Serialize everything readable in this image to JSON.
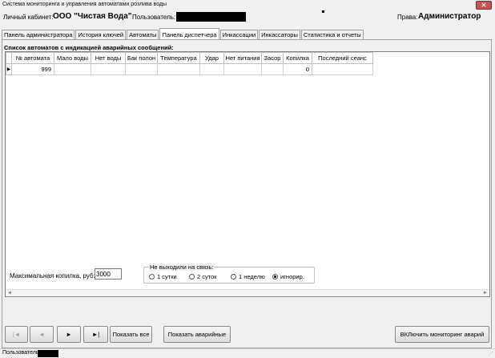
{
  "window": {
    "title": "Система мониторинга и управления автоматами розлива воды",
    "close_glyph": "✕"
  },
  "header": {
    "cabinet_label": "Личный кабинет:",
    "org_name": "ООО \"Чистая Вода\"",
    "user_label": "Пользователь:",
    "rights_label": "Права:",
    "rights_value": "Администратор"
  },
  "tabs": [
    {
      "label": "Панель администратора"
    },
    {
      "label": "История ключей"
    },
    {
      "label": "Автоматы"
    },
    {
      "label": "Панель диспетчера",
      "active": true
    },
    {
      "label": "Инкассации"
    },
    {
      "label": "Инкассаторы"
    },
    {
      "label": "Статистика и отчеты"
    }
  ],
  "panel": {
    "section_title": "Список автоматов с индикацией аварийных сообщений:",
    "columns": [
      "№ автомата",
      "Мало воды",
      "Нет воды",
      "Бак полон",
      "Температура",
      "Удар",
      "Нет питания",
      "Засор",
      "Копилка",
      "Последний сеанс"
    ],
    "rows": [
      {
        "cells": [
          "999",
          "",
          "",
          "",
          "",
          "",
          "",
          "",
          "0",
          ""
        ],
        "selected": true
      }
    ],
    "row_pointer_glyph": "▶"
  },
  "controls": {
    "max_coin_label": "Максимальная копилка, руб:",
    "max_coin_value": "3000",
    "no_contact_legend": "Не выходили на связь:",
    "radio_options": [
      {
        "label": "1 сутки",
        "selected": false
      },
      {
        "label": "2 суток",
        "selected": false
      },
      {
        "label": "1 неделю",
        "selected": false
      },
      {
        "label": "игнорир.",
        "selected": true
      }
    ]
  },
  "nav_buttons": {
    "first": "|◄",
    "prev": "◄",
    "next": "►",
    "last": "►|"
  },
  "buttons": {
    "show_all": "Показать все",
    "show_alarms": "Показать аварийные",
    "monitoring_toggle": "ВКЛючить мониторинг аварий"
  },
  "statusbar": {
    "user_label": "Пользователь"
  },
  "icons": {
    "close": "close-icon",
    "row_pointer": "row-pointer-icon",
    "first": "first-record-icon",
    "prev": "prev-record-icon",
    "next": "next-record-icon",
    "last": "last-record-icon"
  }
}
